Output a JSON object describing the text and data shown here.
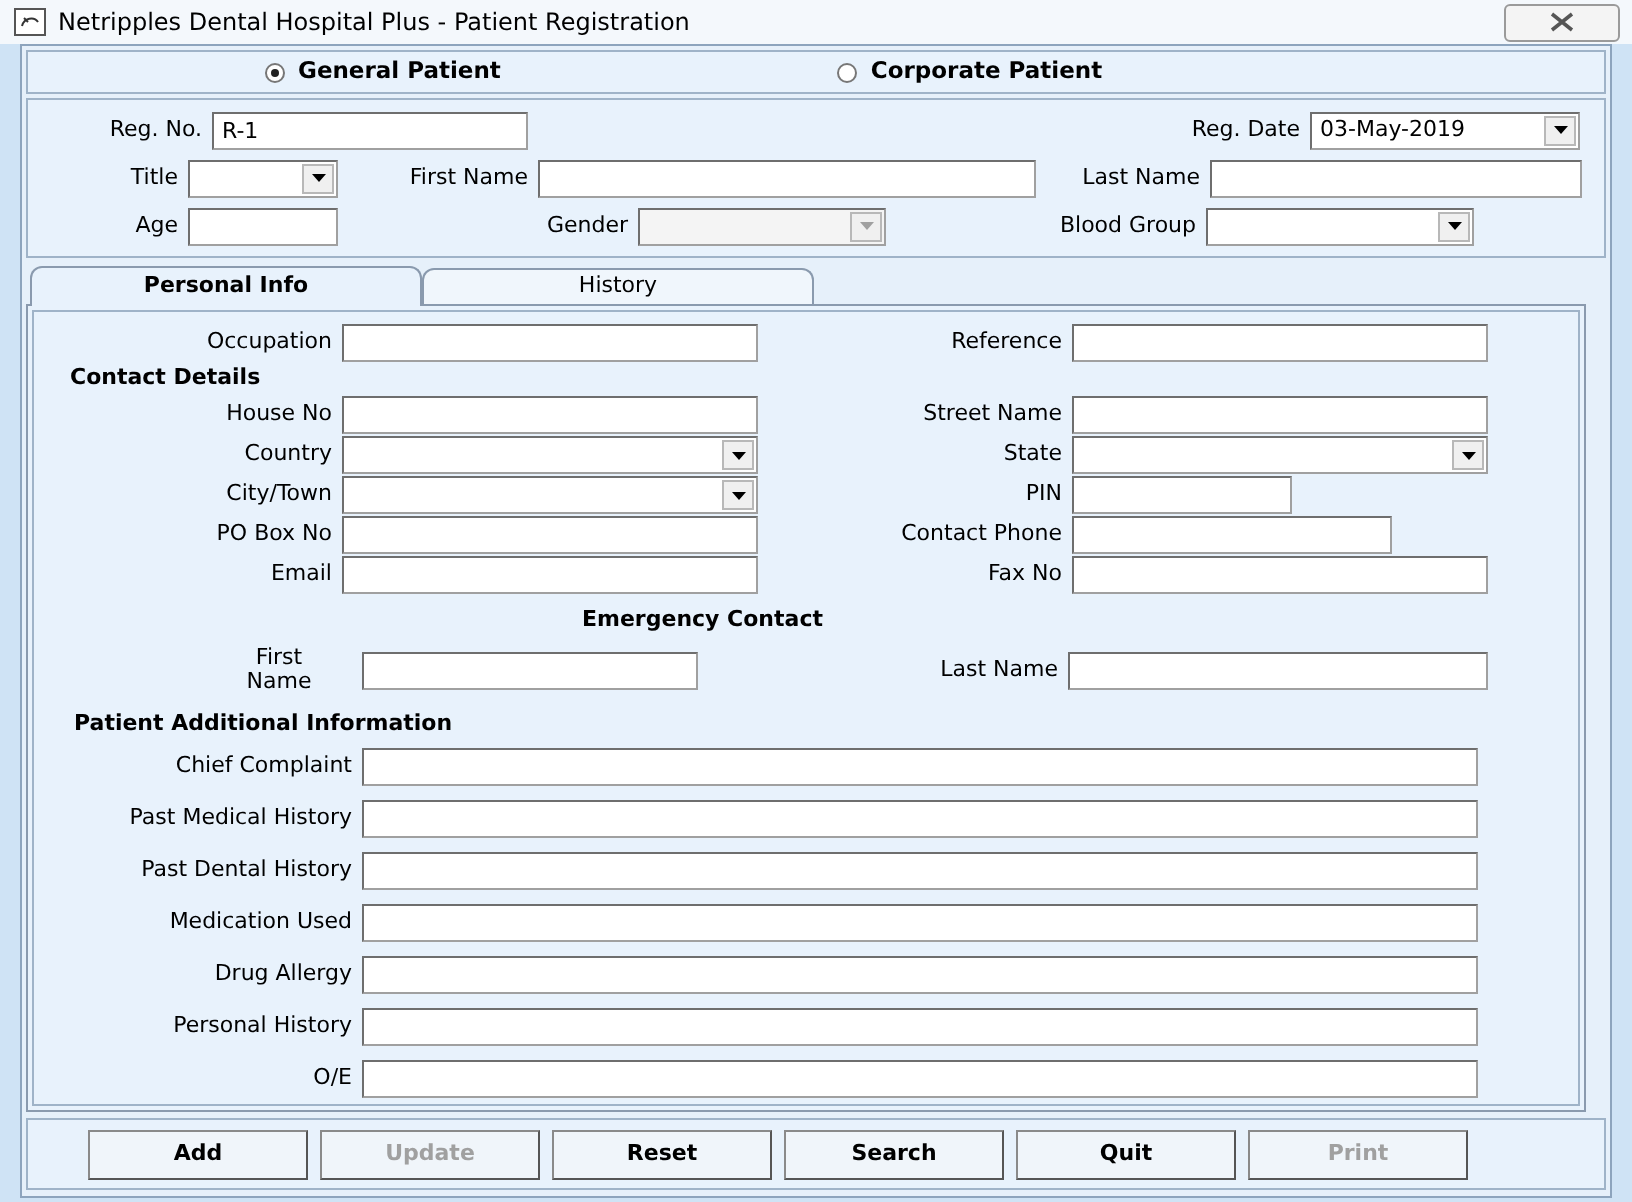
{
  "window": {
    "title": "Netripples Dental Hospital Plus - Patient Registration"
  },
  "patient_type": [
    {
      "label": "General Patient",
      "selected": true
    },
    {
      "label": "Corporate Patient",
      "selected": false
    }
  ],
  "header": {
    "reg_no": {
      "label": "Reg. No.",
      "value": "R-1"
    },
    "reg_date": {
      "label": "Reg. Date",
      "value": "03-May-2019"
    },
    "title": {
      "label": "Title"
    },
    "first_name": {
      "label": "First Name"
    },
    "last_name": {
      "label": "Last Name"
    },
    "age": {
      "label": "Age"
    },
    "gender": {
      "label": "Gender",
      "disabled": true
    },
    "blood_group": {
      "label": "Blood Group",
      "disabled": false
    }
  },
  "tabs": [
    {
      "label": "Personal Info",
      "selected": true
    },
    {
      "label": "History",
      "selected": false
    }
  ],
  "personal_info": {
    "occupation_row": {
      "left": {
        "label": "Occupation",
        "kind": "text"
      },
      "right": {
        "label": "Reference",
        "kind": "text"
      }
    },
    "contact_details": {
      "heading": "Contact Details",
      "rows": [
        {
          "left": {
            "label": "House No",
            "kind": "text"
          },
          "right": {
            "label": "Street Name",
            "kind": "text"
          }
        },
        {
          "left": {
            "label": "Country",
            "kind": "dropdown"
          },
          "right": {
            "label": "State",
            "kind": "dropdown"
          }
        },
        {
          "left": {
            "label": "City/Town",
            "kind": "dropdown"
          },
          "right": {
            "label": "PIN",
            "kind": "short"
          }
        },
        {
          "left": {
            "label": "PO Box No",
            "kind": "text"
          },
          "right": {
            "label": "Contact Phone",
            "kind": "medium"
          }
        },
        {
          "left": {
            "label": "Email",
            "kind": "text"
          },
          "right": {
            "label": "Fax No",
            "kind": "text"
          }
        }
      ]
    },
    "emergency_contact": {
      "heading": "Emergency Contact",
      "first_name": {
        "label": "First Name"
      },
      "last_name": {
        "label": "Last Name"
      }
    },
    "additional_info": {
      "heading": "Patient Additional Information",
      "fields": [
        "Chief Complaint",
        "Past Medical History",
        "Past Dental History",
        "Medication Used",
        "Drug Allergy",
        "Personal History",
        "O/E"
      ]
    }
  },
  "buttons": [
    {
      "label": "Add",
      "disabled": false
    },
    {
      "label": "Update",
      "disabled": true
    },
    {
      "label": "Reset",
      "disabled": false
    },
    {
      "label": "Search",
      "disabled": false
    },
    {
      "label": "Quit",
      "disabled": false
    },
    {
      "label": "Print",
      "disabled": true
    }
  ]
}
